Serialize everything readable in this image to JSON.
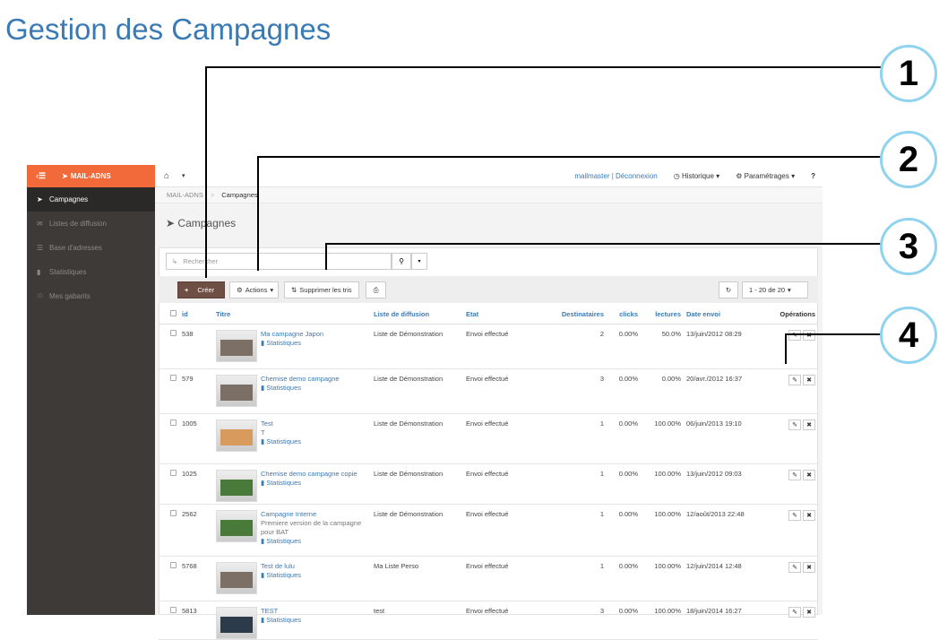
{
  "heading": "Gestion des Campagnes",
  "callouts": [
    "1",
    "2",
    "3",
    "4"
  ],
  "sidebar": {
    "brand": "MAIL-ADNS",
    "items": [
      {
        "label": "Campagnes",
        "icon": "send-icon",
        "active": true
      },
      {
        "label": "Listes de diffusion",
        "icon": "envelope-icon",
        "active": false
      },
      {
        "label": "Base d'adresses",
        "icon": "list-icon",
        "active": false
      },
      {
        "label": "Statistiques",
        "icon": "bar-chart-icon",
        "active": false
      },
      {
        "label": "Mes gabarits",
        "icon": "sitemap-icon",
        "active": false
      }
    ]
  },
  "topbar": {
    "user": "mailmaster | Déconnexion",
    "history": "Historique",
    "settings": "Paramétrages"
  },
  "breadcrumb": {
    "root": "MAIL-ADNS",
    "current": "Campagnes"
  },
  "view_title": "Campagnes",
  "search": {
    "placeholder": "Rechercher"
  },
  "toolbar": {
    "create": "Créer",
    "actions": "Actions",
    "sort": "Supprimer les tris",
    "pager": "1 - 20  de  20"
  },
  "table": {
    "headers": {
      "id": "id",
      "title": "Titre",
      "list": "Liste de diffusion",
      "state": "Etat",
      "recipients": "Destinataires",
      "clicks": "clicks",
      "reads": "lectures",
      "date": "Date envoi",
      "ops": "Opérations"
    },
    "stats_label": "Statistiques",
    "rows": [
      {
        "id": "538",
        "title": "Ma campagne Japon",
        "desc": "",
        "list": "Liste de Démonstration",
        "state": "Envoi effectué",
        "recipients": "2",
        "clicks": "0.00%",
        "reads": "50.0%",
        "date": "13/juin/2012 08:29"
      },
      {
        "id": "579",
        "title": "Chemise demo campagne",
        "desc": "",
        "list": "Liste de Démonstration",
        "state": "Envoi effectué",
        "recipients": "3",
        "clicks": "0.00%",
        "reads": "0.00%",
        "date": "20/avr./2012 16:37"
      },
      {
        "id": "1005",
        "title": "Test",
        "desc": "T",
        "list": "Liste de Démonstration",
        "state": "Envoi effectué",
        "recipients": "1",
        "clicks": "0.00%",
        "reads": "100.00%",
        "date": "06/juin/2013 19:10"
      },
      {
        "id": "1025",
        "title": "Chemise demo campagne copie",
        "desc": "",
        "list": "Liste de Démonstration",
        "state": "Envoi effectué",
        "recipients": "1",
        "clicks": "0.00%",
        "reads": "100.00%",
        "date": "13/juin/2012 09:03"
      },
      {
        "id": "2562",
        "title": "Campagne Interne",
        "desc": "Premiere version de la campagne pour BAT",
        "list": "Liste de Démonstration",
        "state": "Envoi effectué",
        "recipients": "1",
        "clicks": "0.00%",
        "reads": "100.00%",
        "date": "12/août/2013 22:48"
      },
      {
        "id": "5768",
        "title": "Test de lulu",
        "desc": "",
        "list": "Ma Liste Perso",
        "state": "Envoi effectué",
        "recipients": "1",
        "clicks": "0.00%",
        "reads": "100.00%",
        "date": "12/juin/2014 12:48"
      },
      {
        "id": "5813",
        "title": "TEST",
        "desc": "",
        "list": "test",
        "state": "Envoi effectué",
        "recipients": "3",
        "clicks": "0.00%",
        "reads": "100.00%",
        "date": "18/juin/2014 16:27"
      }
    ]
  },
  "colors": {
    "accent": "#f26a3a",
    "link": "#3a7ab5",
    "sidebar": "#3d3a37",
    "create_button": "#6d4f43",
    "callout_border": "#8fd3ef"
  }
}
